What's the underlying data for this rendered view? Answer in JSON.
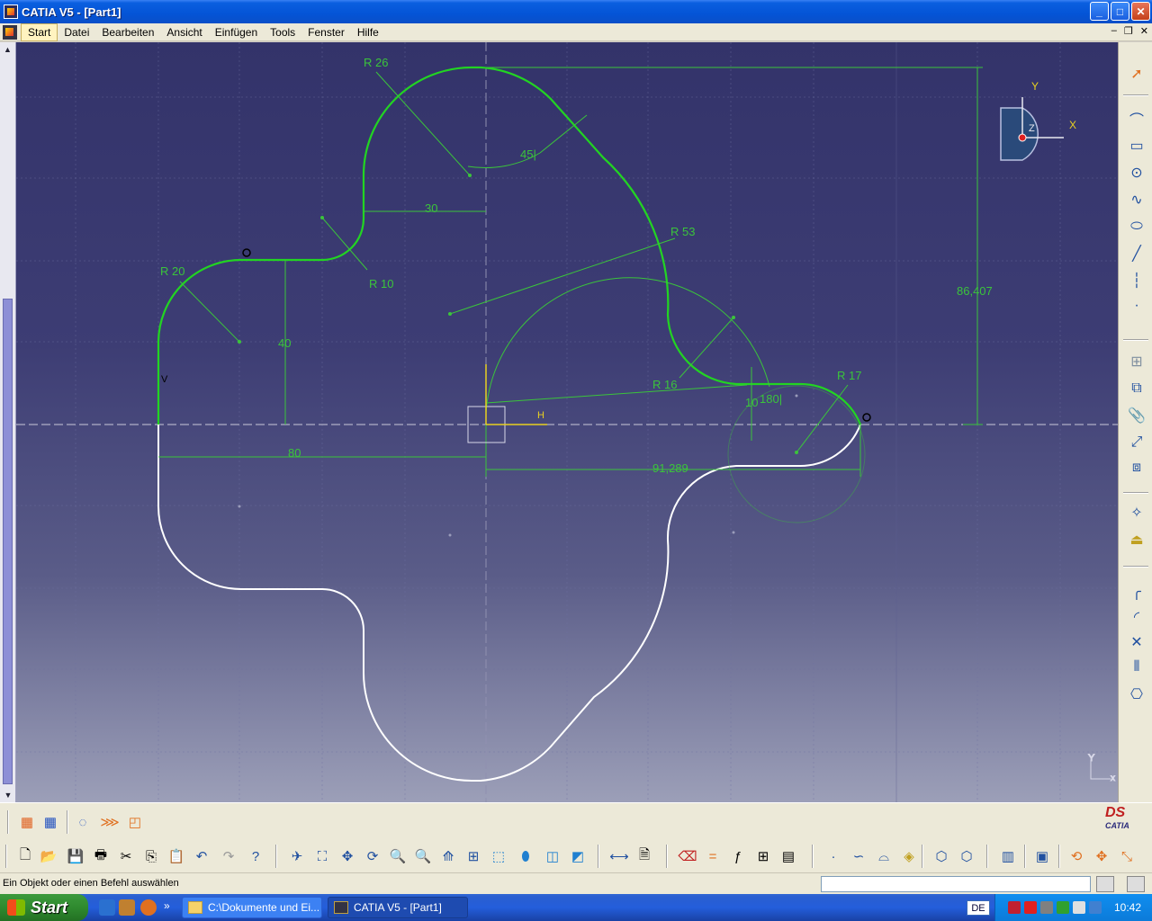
{
  "window": {
    "title": "CATIA V5 - [Part1]",
    "minimize": "_",
    "maximize": "□",
    "close": "✕"
  },
  "menu": {
    "items": [
      "Start",
      "Datei",
      "Bearbeiten",
      "Ansicht",
      "Einfügen",
      "Tools",
      "Fenster",
      "Hilfe"
    ]
  },
  "mdi": {
    "minimize": "–",
    "restore": "❐",
    "close": "✕"
  },
  "sketch": {
    "dimensions": {
      "r26": "R 26",
      "angle45": "45|",
      "d30": "30",
      "r53": "R 53",
      "r10": "R 10",
      "r20": "R 20",
      "d40": "40",
      "d86": "86,407",
      "r16": "R 16",
      "r17": "R 17",
      "d10": "10",
      "angle180": "180|",
      "d80": "80",
      "d91": "91,289"
    },
    "compass": {
      "x": "X",
      "y": "Y",
      "z": "Z"
    },
    "axis_small": {
      "x": "x",
      "y": "Y"
    },
    "origin_labels": {
      "v": "V",
      "h": "H"
    }
  },
  "status": {
    "text": "Ein Objekt oder einen Befehl auswählen"
  },
  "taskbar": {
    "start": "Start",
    "tasks": [
      "C:\\Dokumente und Ei...",
      "CATIA V5 - [Part1]"
    ],
    "language": "DE",
    "clock": "10:42",
    "more": "»"
  },
  "colors": {
    "sketch_green": "#3bc43b",
    "white_profile": "#ffffff",
    "background_top": "#33336a"
  }
}
